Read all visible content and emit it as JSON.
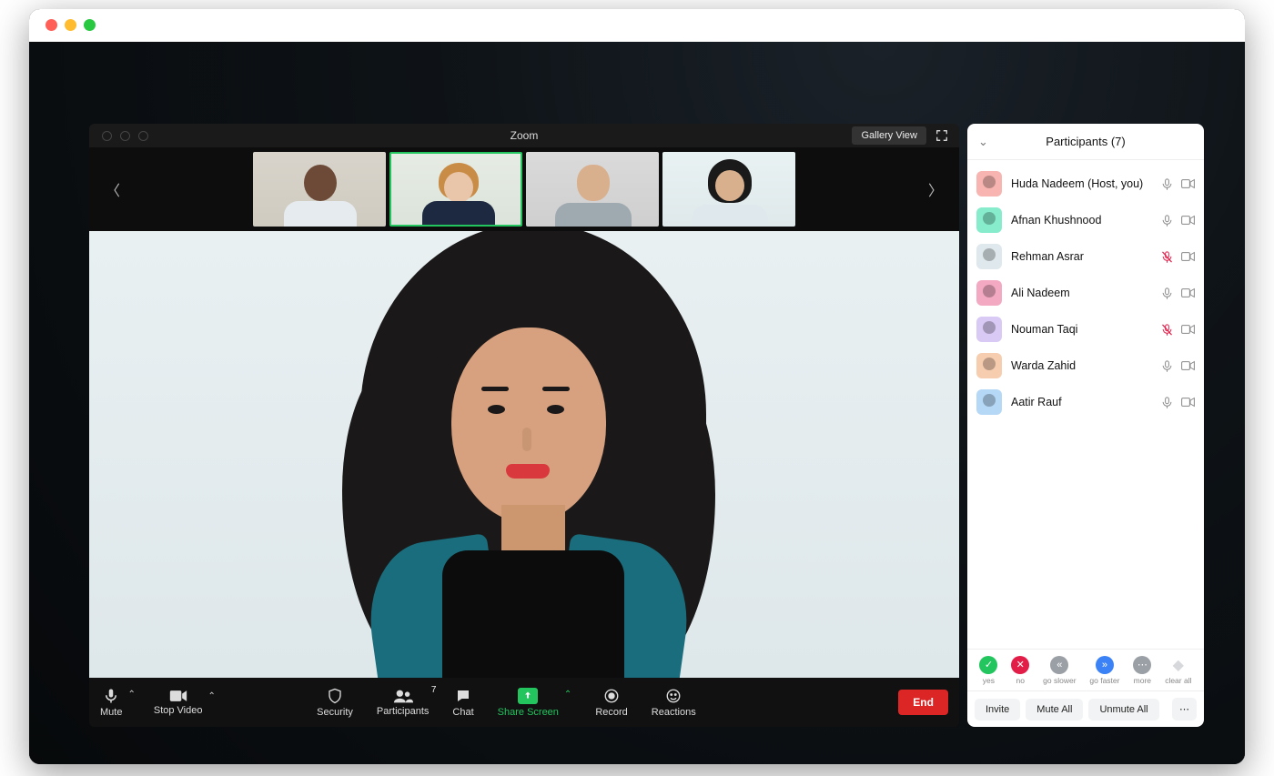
{
  "mac": {
    "title": ""
  },
  "zoom": {
    "title": "Zoom",
    "view_button": "Gallery View",
    "toolbar": {
      "mute": "Mute",
      "stop_video": "Stop Video",
      "security": "Security",
      "participants": "Participants",
      "participants_count": "7",
      "chat": "Chat",
      "share_screen": "Share Screen",
      "record": "Record",
      "reactions": "Reactions",
      "end": "End"
    },
    "thumbnails": [
      {
        "id": "p1",
        "active": false
      },
      {
        "id": "p2",
        "active": true
      },
      {
        "id": "p3",
        "active": false
      },
      {
        "id": "p4",
        "active": false
      }
    ]
  },
  "panel": {
    "title": "Participants (7)",
    "participants": [
      {
        "name": "Huda Nadeem (Host, you)",
        "muted": false,
        "avatar_bg": "#f7b4b0"
      },
      {
        "name": "Afnan Khushnood",
        "muted": false,
        "avatar_bg": "#86eccc"
      },
      {
        "name": "Rehman Asrar",
        "muted": true,
        "avatar_bg": "#dfe8ec"
      },
      {
        "name": "Ali Nadeem",
        "muted": false,
        "avatar_bg": "#f3a9c2"
      },
      {
        "name": "Nouman Taqi",
        "muted": true,
        "avatar_bg": "#d9c9f5"
      },
      {
        "name": "Warda Zahid",
        "muted": false,
        "avatar_bg": "#f7cdb0"
      },
      {
        "name": "Aatir Rauf",
        "muted": false,
        "avatar_bg": "#b5d8f7"
      }
    ],
    "reactions": {
      "yes": {
        "label": "yes",
        "color": "#22c55e",
        "glyph": "✓"
      },
      "no": {
        "label": "no",
        "color": "#e11d48",
        "glyph": "✕"
      },
      "go_slower": {
        "label": "go slower",
        "color": "#9aa0a6",
        "glyph": "«"
      },
      "go_faster": {
        "label": "go faster",
        "color": "#3b82f6",
        "glyph": "»"
      },
      "more": {
        "label": "more",
        "color": "#9aa0a6",
        "glyph": "⋯"
      },
      "clear_all": {
        "label": "clear all",
        "color": "#d6d8db",
        "glyph": "◆"
      }
    },
    "buttons": {
      "invite": "Invite",
      "mute_all": "Mute All",
      "unmute_all": "Unmute All",
      "more": "⋯"
    }
  }
}
